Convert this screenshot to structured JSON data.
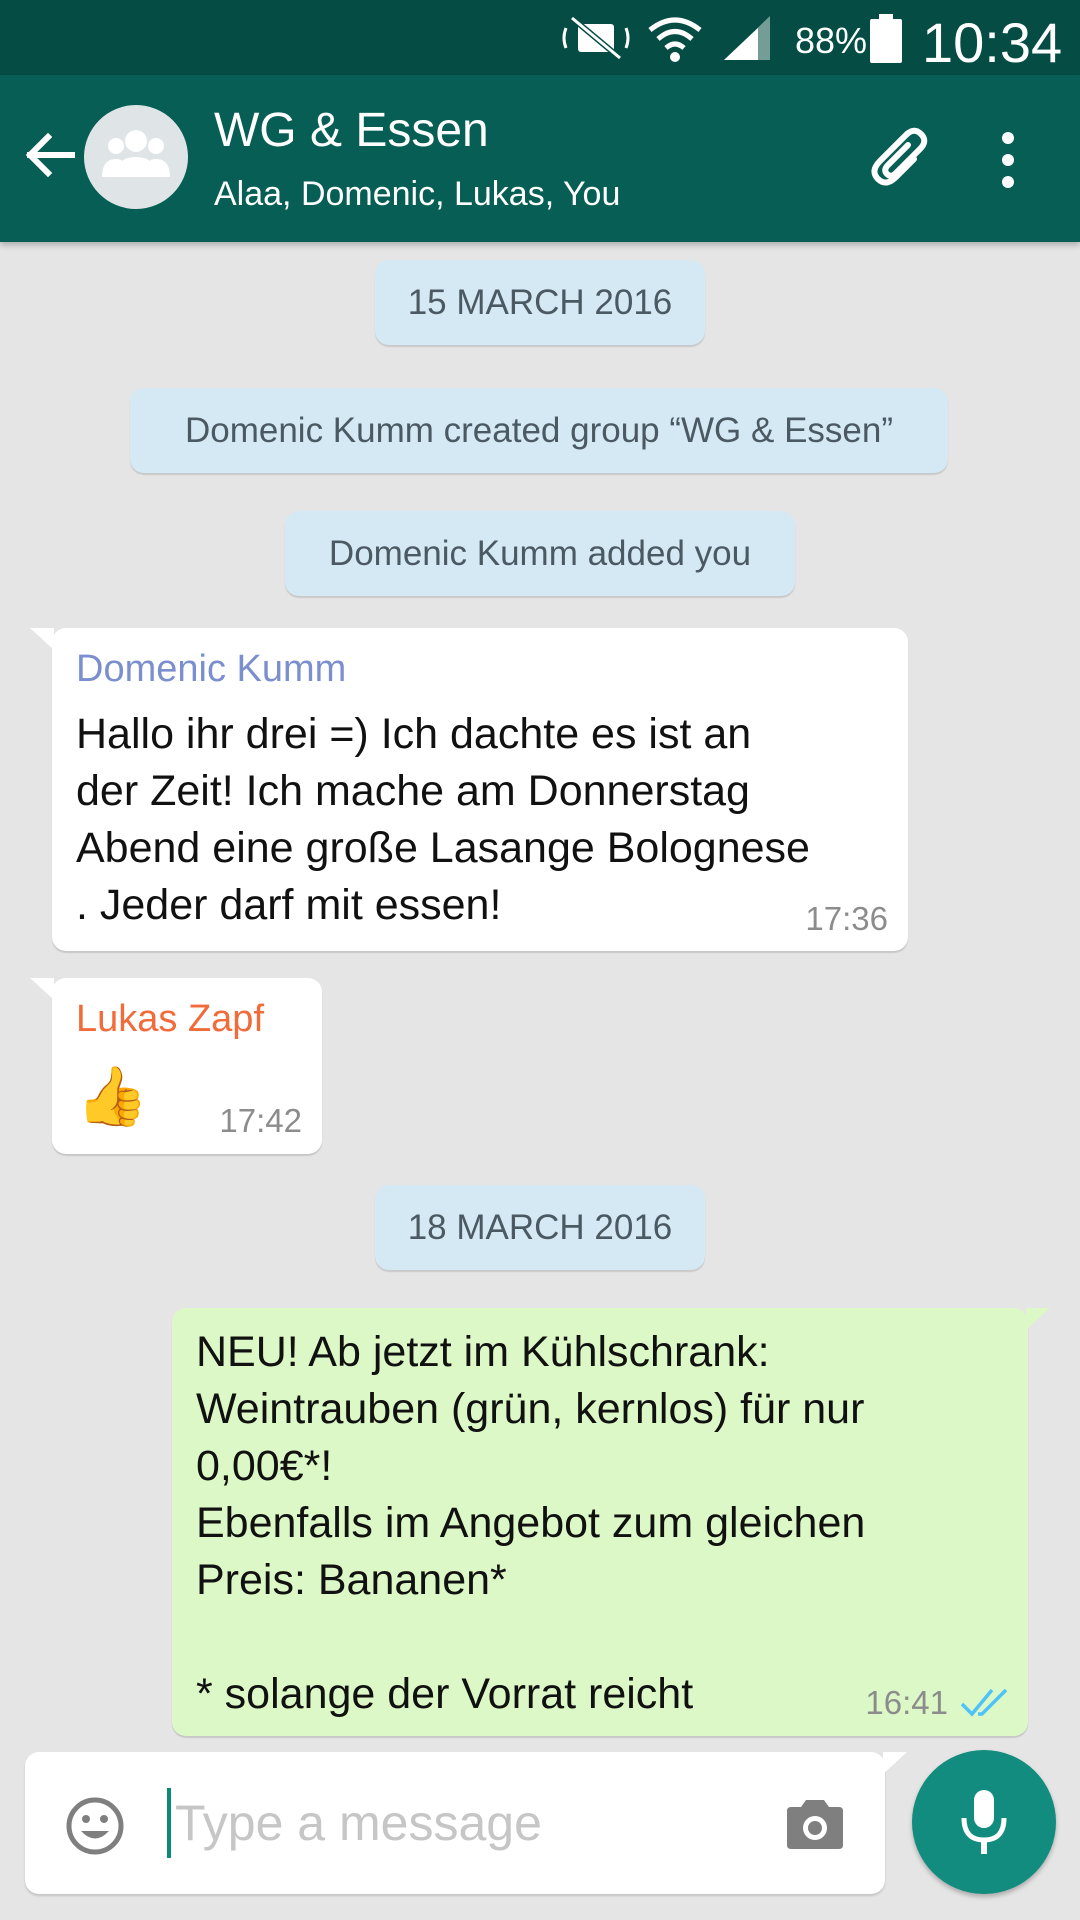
{
  "status_bar": {
    "battery": "88%",
    "time": "10:34",
    "icons": [
      "mute-icon",
      "wifi-icon",
      "signal-icon",
      "battery-icon"
    ]
  },
  "header": {
    "title": "WG & Essen",
    "subtitle": "Alaa, Domenic, Lukas, You",
    "icons": [
      "back-arrow-icon",
      "group-avatar-icon",
      "paperclip-icon",
      "more-vert-icon"
    ]
  },
  "chat": {
    "date_1": "15 MARCH 2016",
    "system_1": "Domenic Kumm created group “WG & Essen”",
    "system_2": "Domenic Kumm added you",
    "message_1": {
      "sender": "Domenic Kumm",
      "sender_color": "#7b8fcf",
      "text": "Hallo ihr drei =) Ich dachte es ist an\nder Zeit! Ich mache am Donnerstag\nAbend eine große Lasange Bolognese\n. Jeder darf mit essen!",
      "time": "17:36"
    },
    "message_2": {
      "sender": "Lukas Zapf",
      "sender_color": "#f26b3a",
      "text": "👍",
      "time": "17:42"
    },
    "date_2": "18 MARCH 2016",
    "message_3": {
      "text": "NEU! Ab jetzt im Kühlschrank:\nWeintrauben (grün, kernlos) für nur\n0,00€*!\nEbenfalls im Angebot zum gleichen\nPreis: Bananen*\n\n* solange der Vorrat reicht",
      "time": "16:41",
      "status_icon": "double-check-read-icon",
      "check_color": "#4fc3f7"
    }
  },
  "composer": {
    "placeholder": "Type a message",
    "icons": [
      "emoji-icon",
      "camera-icon",
      "microphone-icon"
    ],
    "accent": "#128c7e"
  },
  "colors": {
    "status_bar": "#054d44",
    "app_bar": "#075e54",
    "chat_background": "#e5e5e5",
    "outgoing_bubble": "#dcf8c6",
    "system_pill": "#d5e9f5"
  }
}
